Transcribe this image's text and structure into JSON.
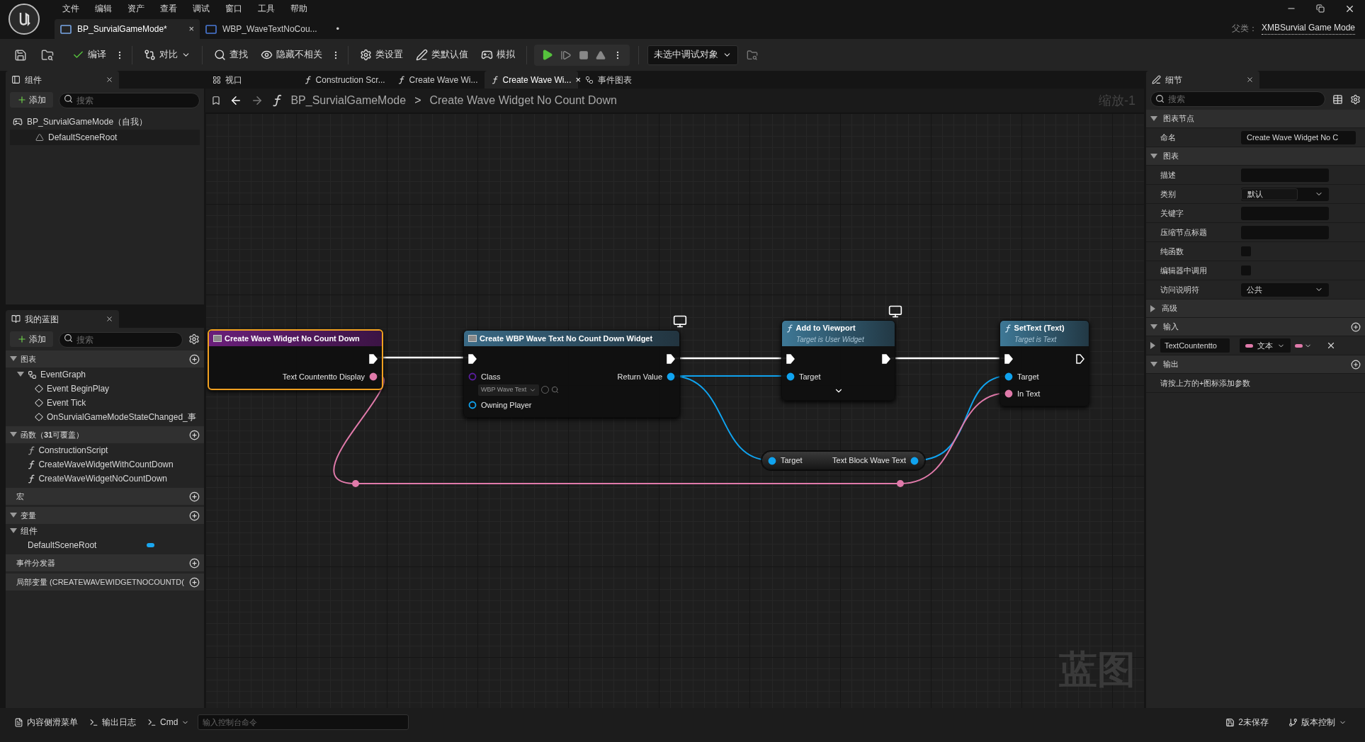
{
  "menu": [
    "文件",
    "编辑",
    "资产",
    "查看",
    "调试",
    "窗口",
    "工具",
    "帮助"
  ],
  "doc_tabs": [
    {
      "label": "BP_SurvialGameMode*",
      "selected": true,
      "mark": "×"
    },
    {
      "label": "WBP_WaveTextNoCou...",
      "selected": false,
      "mark": "•"
    }
  ],
  "parent_class": {
    "label": "父类：",
    "value": "XMBSurvial Game Mode"
  },
  "toolbar": {
    "buttons": [
      "编译",
      "对比",
      "查找",
      "隐藏不相关",
      "类设置",
      "类默认值",
      "模拟"
    ],
    "debug_dropdown": "未选中调试对象"
  },
  "components_panel": {
    "tab": "组件",
    "add": "添加",
    "search_placeholder": "搜索",
    "tree": [
      {
        "label": "BP_SurvialGameMode（自我）",
        "children": [
          {
            "label": "DefaultSceneRoot"
          }
        ]
      }
    ]
  },
  "my_blueprint": {
    "tab": "我的蓝图",
    "add": "添加",
    "search_placeholder": "搜索",
    "sections": [
      {
        "title": "图表",
        "expanded": true,
        "items": [
          {
            "label": "EventGraph",
            "kind": "graph",
            "expanded": true,
            "children": [
              {
                "label": "Event BeginPlay",
                "kind": "event"
              },
              {
                "label": "Event Tick",
                "kind": "event"
              },
              {
                "label": "OnSurvialGameModeStateChanged_事",
                "kind": "event"
              }
            ]
          }
        ]
      },
      {
        "title": "函数（**31**可覆盖）",
        "expanded": true,
        "items": [
          {
            "label": "ConstructionScript",
            "kind": "construction"
          },
          {
            "label": "CreateWaveWidgetWithCountDown",
            "kind": "function"
          },
          {
            "label": "CreateWaveWidgetNoCountDown",
            "kind": "function"
          }
        ]
      },
      {
        "title": "宏"
      },
      {
        "title": "变量",
        "expanded": true,
        "items": [
          {
            "label": "组件",
            "kind": "category",
            "expanded": true,
            "children": [
              {
                "label": "DefaultSceneRoot",
                "kind": "variable",
                "color": "#1aa7f0"
              }
            ]
          }
        ]
      },
      {
        "title": "事件分发器"
      },
      {
        "title": "局部变量 (CREATEWAVEWIDGETNOCOUNTD("
      }
    ]
  },
  "graph_tabs": [
    {
      "label": "视口",
      "selected": false
    },
    {
      "label": "Construction Scr...",
      "selected": false
    },
    {
      "label": "Create Wave Wi...",
      "selected": false
    },
    {
      "label": "Create Wave Wi...",
      "selected": true,
      "close": "×"
    },
    {
      "label": "事件图表",
      "selected": false
    }
  ],
  "breadcrumb": {
    "items": [
      "BP_SurvialGameMode",
      "Create Wave Widget No Count Down"
    ],
    "separator": ">"
  },
  "zoom_label": "缩放-1",
  "graph_label": "蓝图",
  "nodes": [
    {
      "kind": "entry",
      "title": "Create Wave Widget No Count Down",
      "selected": true,
      "client_only": false,
      "outputs": [
        {
          "kind": "exec",
          "connected": true
        },
        {
          "kind": "text",
          "label": "Text Countentto Display",
          "connected": true
        }
      ]
    },
    {
      "kind": "call",
      "title": "Create WBP Wave Text No Count Down Widget",
      "selected": false,
      "client_only": true,
      "inputs": [
        {
          "kind": "exec",
          "connected": true
        },
        {
          "kind": "class",
          "label": "Class",
          "value": "WBP Wave Text",
          "connected": false
        },
        {
          "kind": "object",
          "label": "Owning Player",
          "connected": false
        }
      ],
      "outputs": [
        {
          "kind": "exec",
          "connected": true
        },
        {
          "kind": "object",
          "label": "Return Value",
          "connected": true
        }
      ]
    },
    {
      "kind": "function",
      "title": "Add to Viewport",
      "subtitle": "Target is User Widget",
      "selected": false,
      "client_only": true,
      "advanced": true,
      "inputs": [
        {
          "kind": "exec",
          "connected": true
        },
        {
          "kind": "object",
          "label": "Target",
          "connected": true
        }
      ],
      "outputs": [
        {
          "kind": "exec",
          "connected": true
        }
      ]
    },
    {
      "kind": "function",
      "title": "SetText (Text)",
      "subtitle": "Target is Text",
      "selected": false,
      "client_only": false,
      "inputs": [
        {
          "kind": "exec",
          "connected": true
        },
        {
          "kind": "object",
          "label": "Target",
          "connected": true
        },
        {
          "kind": "text",
          "label": "In Text",
          "connected": true
        }
      ],
      "outputs": [
        {
          "kind": "exec",
          "connected": false
        }
      ]
    },
    {
      "kind": "getter",
      "selected": false,
      "client_only": false,
      "inputs": [
        {
          "kind": "object",
          "label": "Target",
          "connected": true
        }
      ],
      "outputs": [
        {
          "kind": "object",
          "label": "Text Block Wave Text",
          "connected": true
        }
      ]
    }
  ],
  "details": {
    "tab": "细节",
    "search_placeholder": "搜索",
    "sections": [
      {
        "title": "图表节点",
        "expanded": true,
        "rows": [
          {
            "label": "命名",
            "kind": "field",
            "value": "Create Wave Widget No C"
          }
        ]
      },
      {
        "title": "图表",
        "expanded": true,
        "rows": [
          {
            "label": "描述",
            "kind": "field"
          },
          {
            "label": "类别",
            "kind": "combo",
            "value": "默认"
          },
          {
            "label": "关键字",
            "kind": "field"
          },
          {
            "label": "压缩节点标题",
            "kind": "field"
          },
          {
            "label": "纯函数",
            "kind": "checkbox",
            "checked": false
          },
          {
            "label": "编辑器中调用",
            "kind": "checkbox",
            "checked": false
          },
          {
            "label": "访问说明符",
            "kind": "dropdown",
            "value": "公共"
          }
        ]
      },
      {
        "title": "高级",
        "expanded": false
      },
      {
        "title": "输入",
        "expanded": true,
        "addable": true,
        "rows": [
          {
            "kind": "param",
            "name": "TextCountentto",
            "type": "文本"
          }
        ]
      },
      {
        "title": "输出",
        "expanded": true,
        "addable": true,
        "rows": [
          {
            "kind": "note",
            "text": "请按上方的+图标添加参数"
          }
        ]
      }
    ]
  },
  "bottom_bar": {
    "left": [
      "内容侧滑菜单",
      "输出日志",
      "Cmd"
    ],
    "console_placeholder": "输入控制台命令",
    "right": [
      "2未保存",
      "版本控制"
    ]
  }
}
